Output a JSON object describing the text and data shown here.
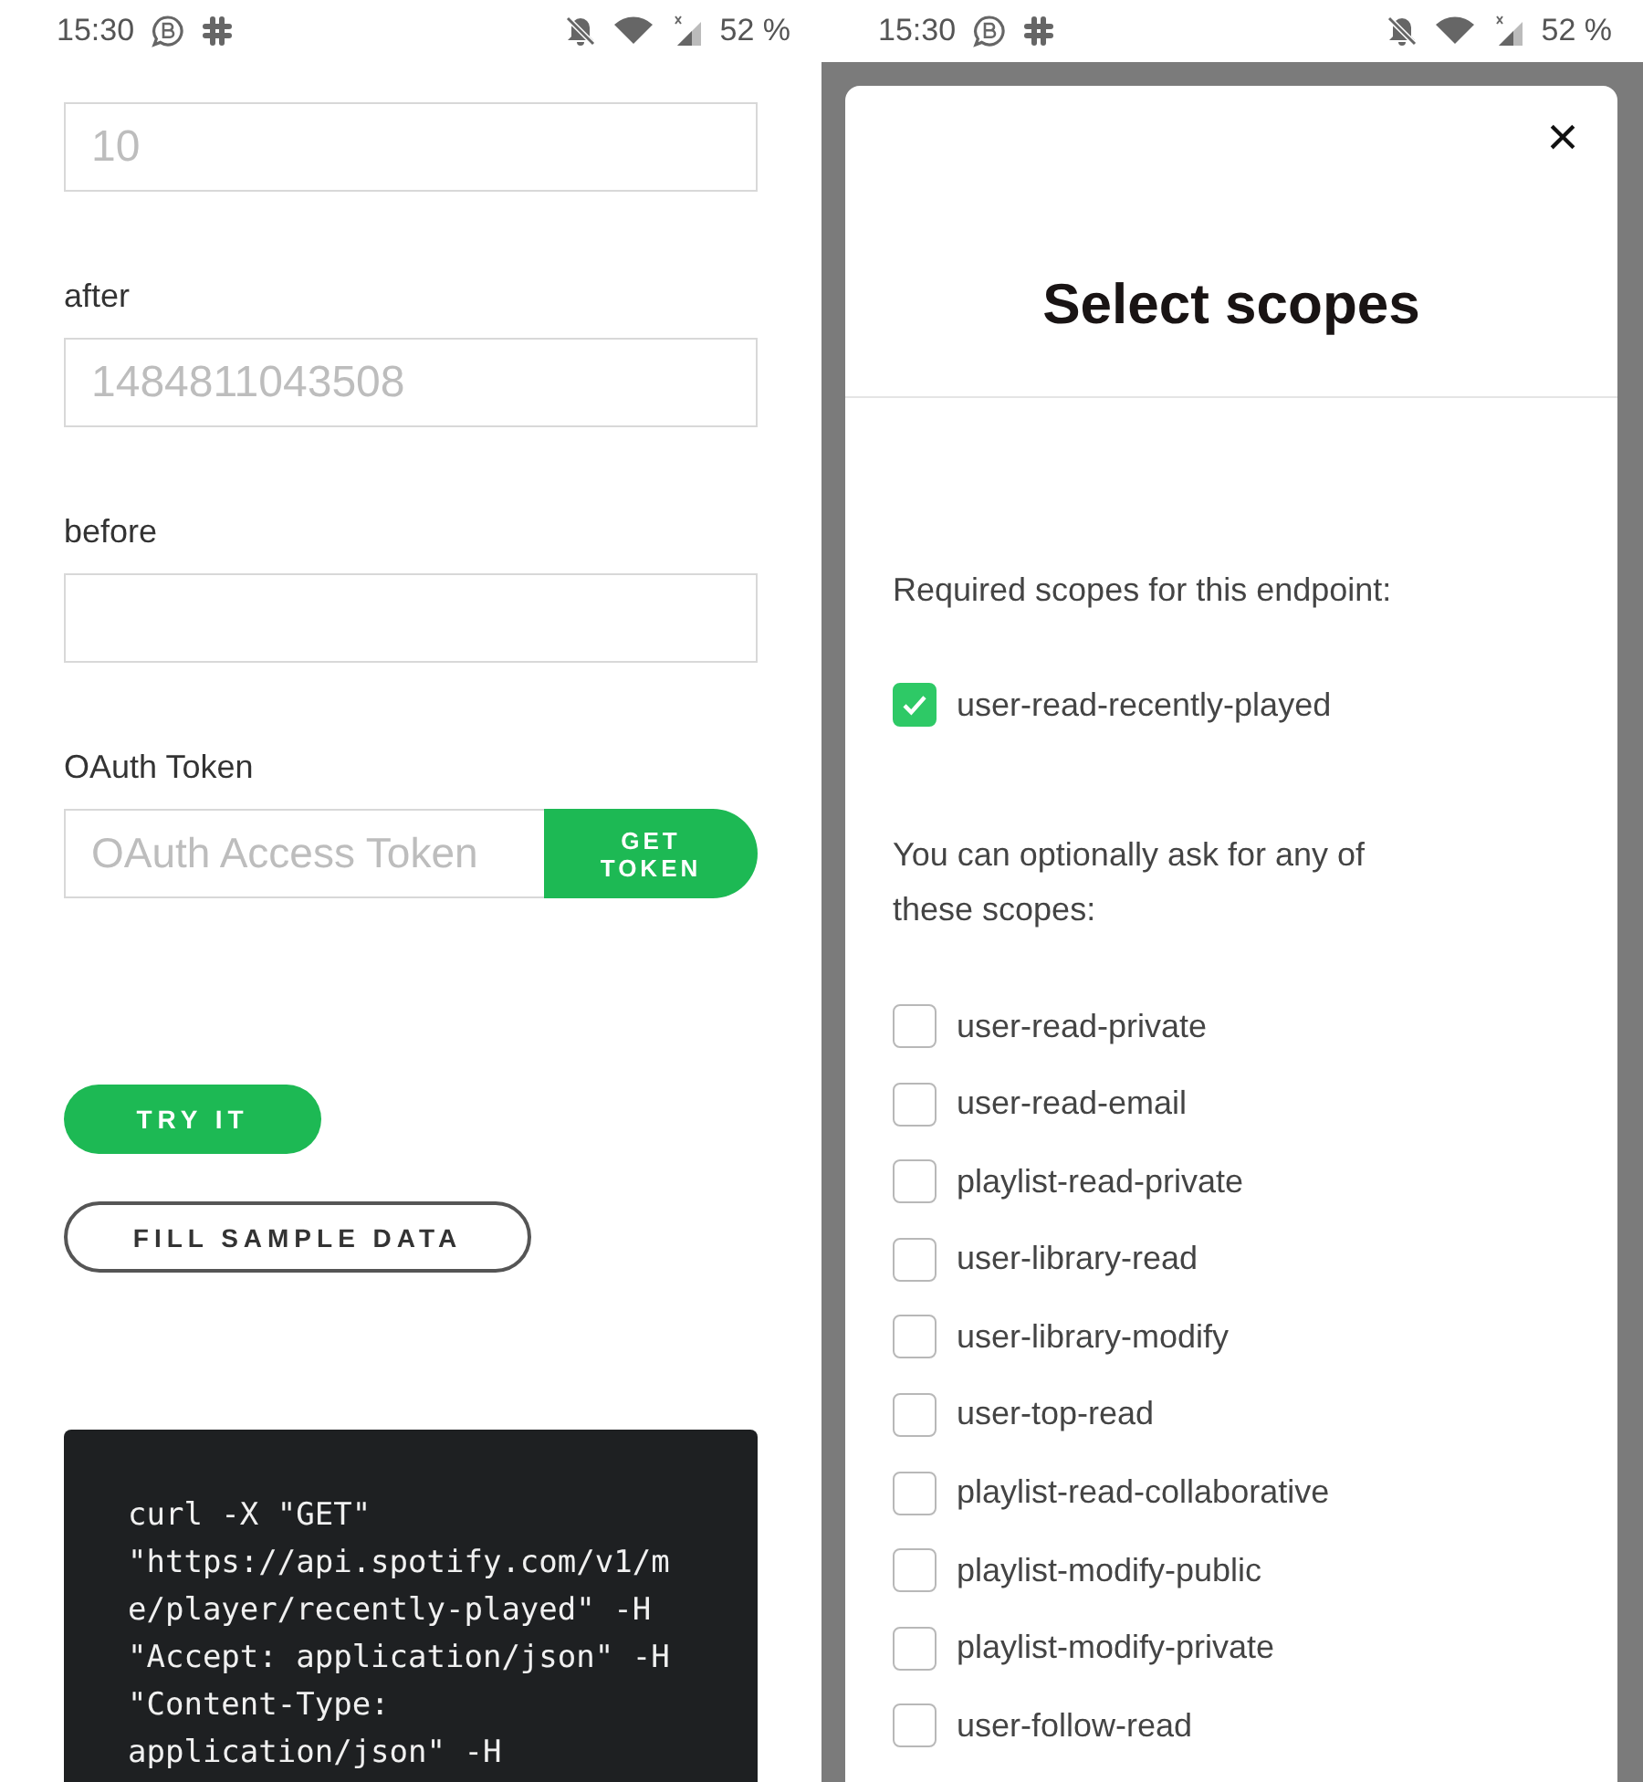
{
  "left_screen": {
    "status_bar": {
      "time": "15:30",
      "battery": "52 %"
    },
    "fields": [
      {
        "placeholder": "10"
      },
      {
        "label": "after",
        "placeholder": "1484811043508"
      },
      {
        "label": "before"
      }
    ],
    "oauth": {
      "label": "OAuth Token",
      "placeholder": "OAuth Access Token",
      "button": "GET TOKEN"
    },
    "try_button": "TRY IT",
    "sample_button": "FILL SAMPLE DATA",
    "code_lines": [
      "curl -X \"GET\"",
      "\"https://api.spotify.com/v1/m",
      "e/player/recently-played\" -H",
      "\"Accept: application/json\" -H",
      "\"Content-Type:",
      "application/json\" -H"
    ]
  },
  "right_screen": {
    "status_bar": {
      "time": "15:30",
      "battery": "52 %"
    },
    "dialog": {
      "title": "Select scopes",
      "close": "×",
      "required_label": "Required scopes for this endpoint:",
      "required_scopes": [
        {
          "label": "user-read-recently-played",
          "checked": true
        }
      ],
      "optional_label": "You can optionally ask for any of these scopes:",
      "optional_scopes": [
        {
          "label": "user-read-private",
          "checked": false
        },
        {
          "label": "user-read-email",
          "checked": false
        },
        {
          "label": "playlist-read-private",
          "checked": false
        },
        {
          "label": "user-library-read",
          "checked": false
        },
        {
          "label": "user-library-modify",
          "checked": false
        },
        {
          "label": "user-top-read",
          "checked": false
        },
        {
          "label": "playlist-read-collaborative",
          "checked": false
        },
        {
          "label": "playlist-modify-public",
          "checked": false
        },
        {
          "label": "playlist-modify-private",
          "checked": false
        },
        {
          "label": "user-follow-read",
          "checked": false
        }
      ]
    }
  }
}
